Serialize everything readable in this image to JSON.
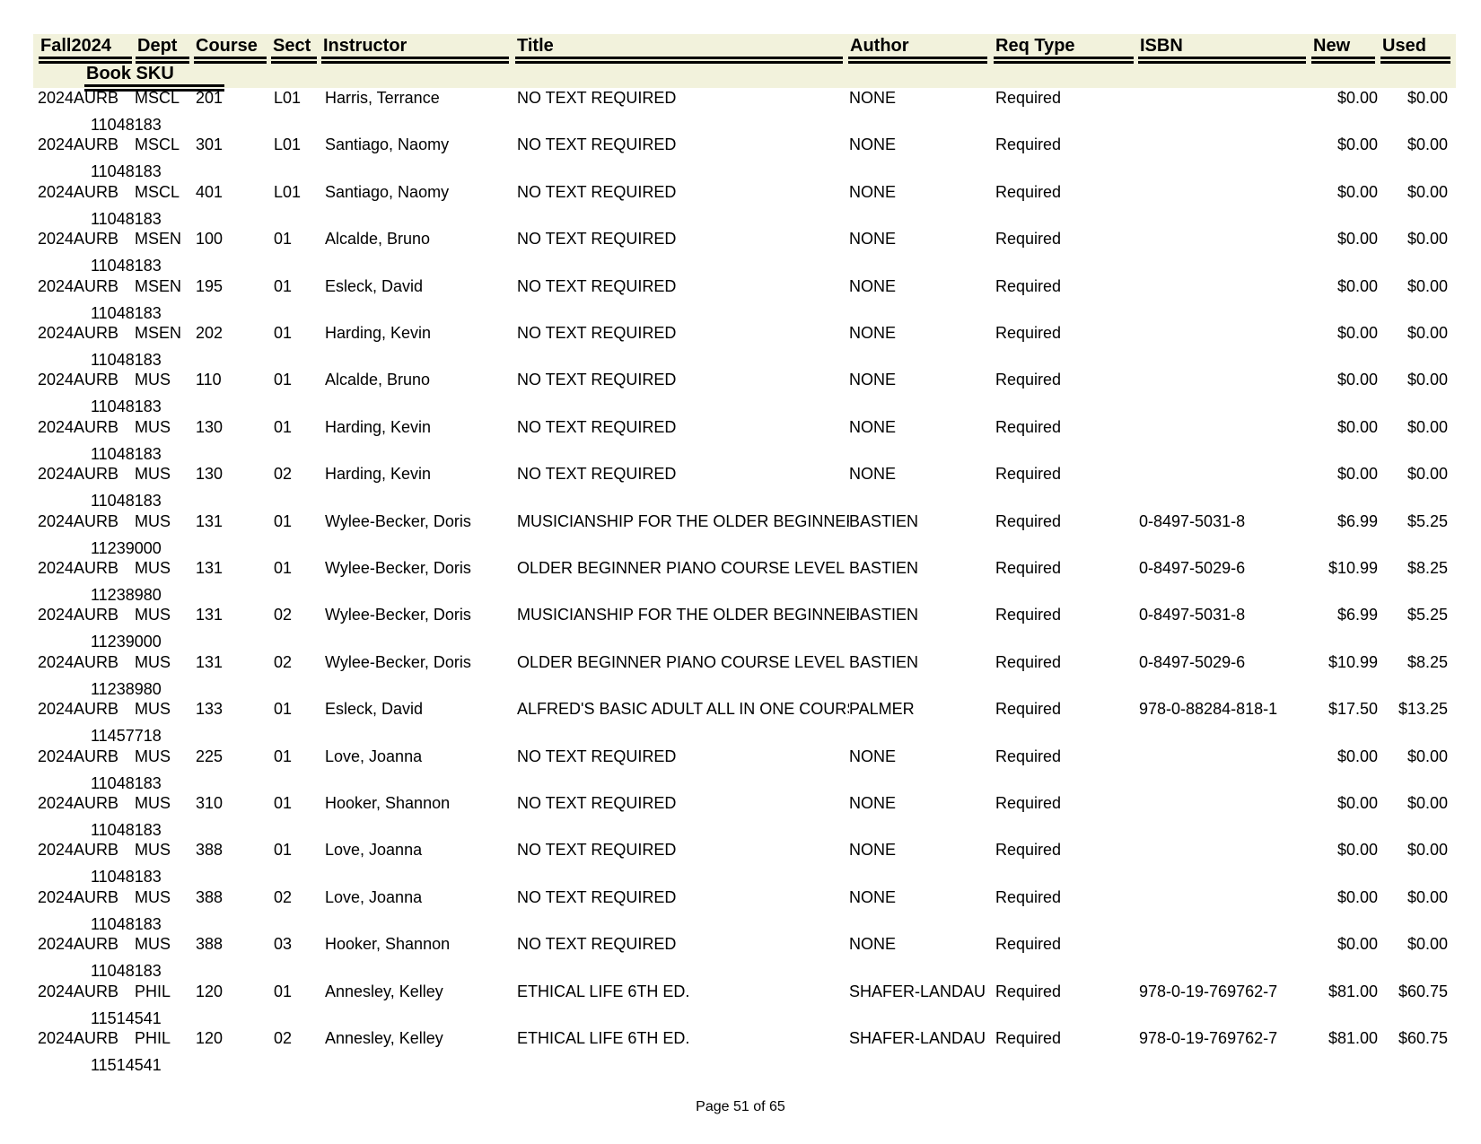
{
  "header": {
    "columns": [
      {
        "key": "term",
        "label": "Fall2024"
      },
      {
        "key": "dept",
        "label": "Dept"
      },
      {
        "key": "course",
        "label": "Course"
      },
      {
        "key": "sect",
        "label": "Sect"
      },
      {
        "key": "instructor",
        "label": "Instructor"
      },
      {
        "key": "title",
        "label": "Title"
      },
      {
        "key": "author",
        "label": "Author"
      },
      {
        "key": "req_type",
        "label": "Req Type"
      },
      {
        "key": "isbn",
        "label": "ISBN"
      },
      {
        "key": "new",
        "label": "New"
      },
      {
        "key": "used",
        "label": "Used"
      }
    ],
    "sub_label": "Book SKU"
  },
  "rows": [
    {
      "term": "2024AURB",
      "dept": "MSCL",
      "course": "201",
      "sect": "L01",
      "instructor": "Harris, Terrance",
      "title": "NO TEXT REQUIRED",
      "author": "NONE",
      "req_type": "Required",
      "isbn": "",
      "new": "$0.00",
      "used": "$0.00",
      "sku": "11048183"
    },
    {
      "term": "2024AURB",
      "dept": "MSCL",
      "course": "301",
      "sect": "L01",
      "instructor": "Santiago, Naomy",
      "title": "NO TEXT REQUIRED",
      "author": "NONE",
      "req_type": "Required",
      "isbn": "",
      "new": "$0.00",
      "used": "$0.00",
      "sku": "11048183"
    },
    {
      "term": "2024AURB",
      "dept": "MSCL",
      "course": "401",
      "sect": "L01",
      "instructor": "Santiago, Naomy",
      "title": "NO TEXT REQUIRED",
      "author": "NONE",
      "req_type": "Required",
      "isbn": "",
      "new": "$0.00",
      "used": "$0.00",
      "sku": "11048183"
    },
    {
      "term": "2024AURB",
      "dept": "MSEN",
      "course": "100",
      "sect": "01",
      "instructor": "Alcalde, Bruno",
      "title": "NO TEXT REQUIRED",
      "author": "NONE",
      "req_type": "Required",
      "isbn": "",
      "new": "$0.00",
      "used": "$0.00",
      "sku": "11048183"
    },
    {
      "term": "2024AURB",
      "dept": "MSEN",
      "course": "195",
      "sect": "01",
      "instructor": "Esleck, David",
      "title": "NO TEXT REQUIRED",
      "author": "NONE",
      "req_type": "Required",
      "isbn": "",
      "new": "$0.00",
      "used": "$0.00",
      "sku": "11048183"
    },
    {
      "term": "2024AURB",
      "dept": "MSEN",
      "course": "202",
      "sect": "01",
      "instructor": "Harding, Kevin",
      "title": "NO TEXT REQUIRED",
      "author": "NONE",
      "req_type": "Required",
      "isbn": "",
      "new": "$0.00",
      "used": "$0.00",
      "sku": "11048183"
    },
    {
      "term": "2024AURB",
      "dept": "MUS",
      "course": "110",
      "sect": "01",
      "instructor": "Alcalde, Bruno",
      "title": "NO TEXT REQUIRED",
      "author": "NONE",
      "req_type": "Required",
      "isbn": "",
      "new": "$0.00",
      "used": "$0.00",
      "sku": "11048183"
    },
    {
      "term": "2024AURB",
      "dept": "MUS",
      "course": "130",
      "sect": "01",
      "instructor": "Harding, Kevin",
      "title": "NO TEXT REQUIRED",
      "author": "NONE",
      "req_type": "Required",
      "isbn": "",
      "new": "$0.00",
      "used": "$0.00",
      "sku": "11048183"
    },
    {
      "term": "2024AURB",
      "dept": "MUS",
      "course": "130",
      "sect": "02",
      "instructor": "Harding, Kevin",
      "title": "NO TEXT REQUIRED",
      "author": "NONE",
      "req_type": "Required",
      "isbn": "",
      "new": "$0.00",
      "used": "$0.00",
      "sku": "11048183"
    },
    {
      "term": "2024AURB",
      "dept": "MUS",
      "course": "131",
      "sect": "01",
      "instructor": "Wylee-Becker, Doris",
      "title": "MUSICIANSHIP FOR THE OLDER BEGINNER",
      "author": "BASTIEN",
      "req_type": "Required",
      "isbn": "0-8497-5031-8",
      "new": "$6.99",
      "used": "$5.25",
      "sku": "11239000"
    },
    {
      "term": "2024AURB",
      "dept": "MUS",
      "course": "131",
      "sect": "01",
      "instructor": "Wylee-Becker, Doris",
      "title": "OLDER BEGINNER PIANO COURSE LEVEL",
      "author": "BASTIEN",
      "req_type": "Required",
      "isbn": "0-8497-5029-6",
      "new": "$10.99",
      "used": "$8.25",
      "sku": "11238980"
    },
    {
      "term": "2024AURB",
      "dept": "MUS",
      "course": "131",
      "sect": "02",
      "instructor": "Wylee-Becker, Doris",
      "title": "MUSICIANSHIP FOR THE OLDER BEGINNER",
      "author": "BASTIEN",
      "req_type": "Required",
      "isbn": "0-8497-5031-8",
      "new": "$6.99",
      "used": "$5.25",
      "sku": "11239000"
    },
    {
      "term": "2024AURB",
      "dept": "MUS",
      "course": "131",
      "sect": "02",
      "instructor": "Wylee-Becker, Doris",
      "title": "OLDER BEGINNER PIANO COURSE LEVEL",
      "author": "BASTIEN",
      "req_type": "Required",
      "isbn": "0-8497-5029-6",
      "new": "$10.99",
      "used": "$8.25",
      "sku": "11238980"
    },
    {
      "term": "2024AURB",
      "dept": "MUS",
      "course": "133",
      "sect": "01",
      "instructor": "Esleck, David",
      "title": "ALFRED'S BASIC ADULT ALL IN ONE COURSE",
      "author": "PALMER",
      "req_type": "Required",
      "isbn": "978-0-88284-818-1",
      "new": "$17.50",
      "used": "$13.25",
      "sku": "11457718"
    },
    {
      "term": "2024AURB",
      "dept": "MUS",
      "course": "225",
      "sect": "01",
      "instructor": "Love, Joanna",
      "title": "NO TEXT REQUIRED",
      "author": "NONE",
      "req_type": "Required",
      "isbn": "",
      "new": "$0.00",
      "used": "$0.00",
      "sku": "11048183"
    },
    {
      "term": "2024AURB",
      "dept": "MUS",
      "course": "310",
      "sect": "01",
      "instructor": "Hooker, Shannon",
      "title": "NO TEXT REQUIRED",
      "author": "NONE",
      "req_type": "Required",
      "isbn": "",
      "new": "$0.00",
      "used": "$0.00",
      "sku": "11048183"
    },
    {
      "term": "2024AURB",
      "dept": "MUS",
      "course": "388",
      "sect": "01",
      "instructor": "Love, Joanna",
      "title": "NO TEXT REQUIRED",
      "author": "NONE",
      "req_type": "Required",
      "isbn": "",
      "new": "$0.00",
      "used": "$0.00",
      "sku": "11048183"
    },
    {
      "term": "2024AURB",
      "dept": "MUS",
      "course": "388",
      "sect": "02",
      "instructor": "Love, Joanna",
      "title": "NO TEXT REQUIRED",
      "author": "NONE",
      "req_type": "Required",
      "isbn": "",
      "new": "$0.00",
      "used": "$0.00",
      "sku": "11048183"
    },
    {
      "term": "2024AURB",
      "dept": "MUS",
      "course": "388",
      "sect": "03",
      "instructor": "Hooker, Shannon",
      "title": "NO TEXT REQUIRED",
      "author": "NONE",
      "req_type": "Required",
      "isbn": "",
      "new": "$0.00",
      "used": "$0.00",
      "sku": "11048183"
    },
    {
      "term": "2024AURB",
      "dept": "PHIL",
      "course": "120",
      "sect": "01",
      "instructor": "Annesley, Kelley",
      "title": "ETHICAL LIFE 6TH ED.",
      "author": "SHAFER-LANDAU",
      "req_type": "Required",
      "isbn": "978-0-19-769762-7",
      "new": "$81.00",
      "used": "$60.75",
      "sku": "11514541"
    },
    {
      "term": "2024AURB",
      "dept": "PHIL",
      "course": "120",
      "sect": "02",
      "instructor": "Annesley, Kelley",
      "title": "ETHICAL LIFE 6TH ED.",
      "author": "SHAFER-LANDAU",
      "req_type": "Required",
      "isbn": "978-0-19-769762-7",
      "new": "$81.00",
      "used": "$60.75",
      "sku": "11514541"
    }
  ],
  "footer": {
    "page_label": "Page 51 of 65"
  }
}
